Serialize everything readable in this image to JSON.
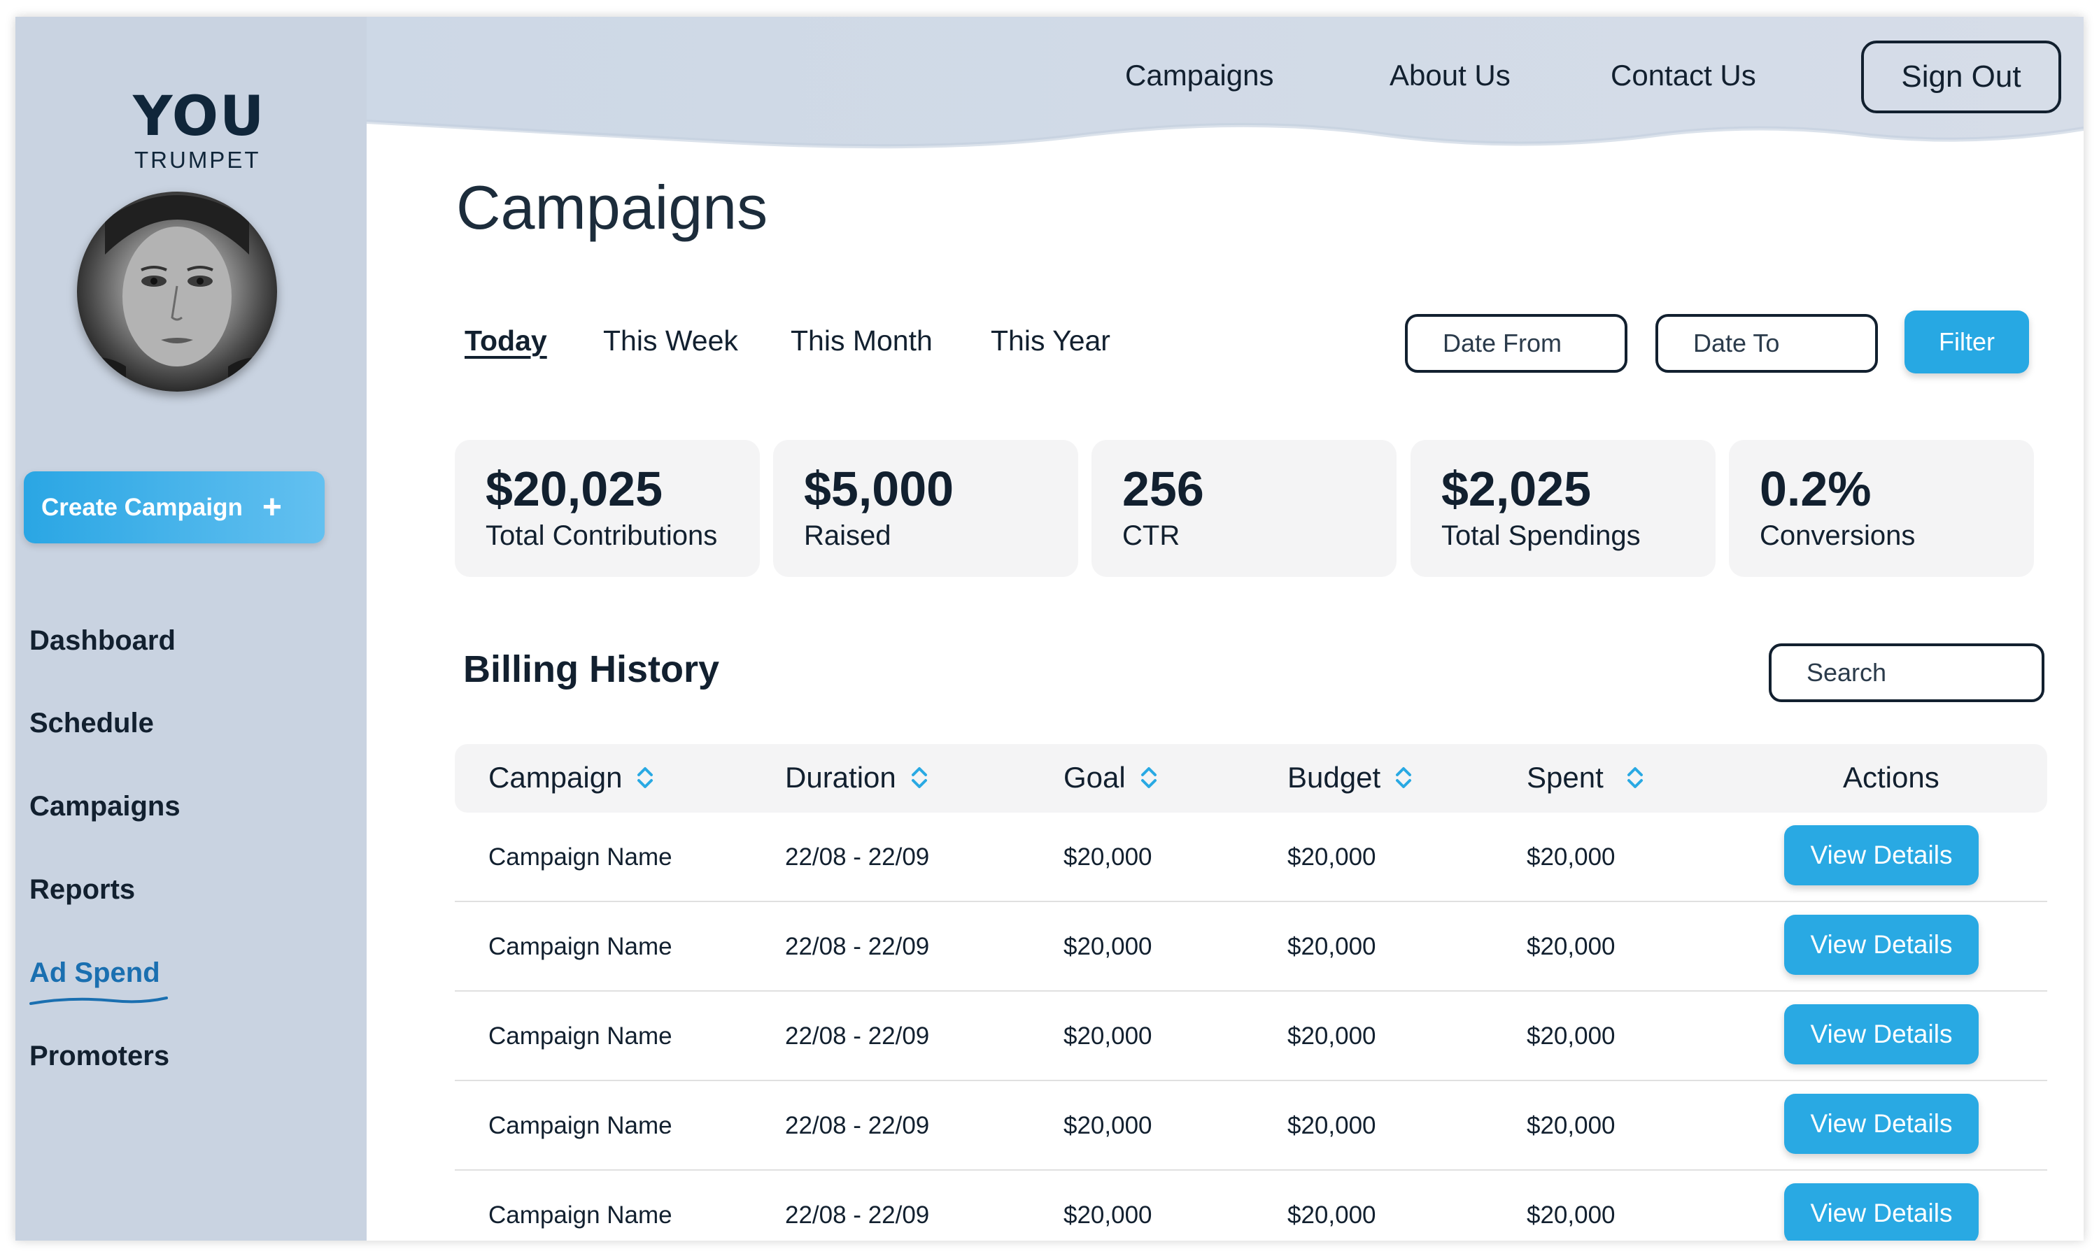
{
  "app": {
    "logo_you": "YOU",
    "logo_trumpet": "TRUMPET"
  },
  "sidebar": {
    "create_label": "Create Campaign",
    "create_icon": "+",
    "items": [
      {
        "label": "Dashboard",
        "active": false
      },
      {
        "label": "Schedule",
        "active": false
      },
      {
        "label": "Campaigns",
        "active": false
      },
      {
        "label": "Reports",
        "active": false
      },
      {
        "label": "Ad Spend",
        "active": true
      },
      {
        "label": "Promoters",
        "active": false
      }
    ]
  },
  "header": {
    "links": [
      "Campaigns",
      "About Us",
      "Contact Us"
    ],
    "signout_label": "Sign Out"
  },
  "main": {
    "title": "Campaigns",
    "tabs": [
      {
        "label": "Today",
        "active": true
      },
      {
        "label": "This Week",
        "active": false
      },
      {
        "label": "This Month",
        "active": false
      },
      {
        "label": "This Year",
        "active": false
      }
    ],
    "date_from_placeholder": "Date From",
    "date_to_placeholder": "Date To",
    "filter_label": "Filter",
    "stats": [
      {
        "value": "$20,025",
        "label": "Total Contributions"
      },
      {
        "value": "$5,000",
        "label": "Raised"
      },
      {
        "value": "256",
        "label": "CTR"
      },
      {
        "value": "$2,025",
        "label": "Total Spendings"
      },
      {
        "value": "0.2%",
        "label": "Conversions"
      }
    ]
  },
  "billing": {
    "title": "Billing History",
    "search_placeholder": "Search",
    "columns": [
      "Campaign",
      "Duration",
      "Goal",
      "Budget",
      "Spent",
      "Actions"
    ],
    "action_label": "View Details",
    "rows": [
      {
        "campaign": "Campaign Name",
        "duration": "22/08 - 22/09",
        "goal": "$20,000",
        "budget": "$20,000",
        "spent": "$20,000"
      },
      {
        "campaign": "Campaign Name",
        "duration": "22/08 - 22/09",
        "goal": "$20,000",
        "budget": "$20,000",
        "spent": "$20,000"
      },
      {
        "campaign": "Campaign Name",
        "duration": "22/08 - 22/09",
        "goal": "$20,000",
        "budget": "$20,000",
        "spent": "$20,000"
      },
      {
        "campaign": "Campaign Name",
        "duration": "22/08 - 22/09",
        "goal": "$20,000",
        "budget": "$20,000",
        "spent": "$20,000"
      },
      {
        "campaign": "Campaign Name",
        "duration": "22/08 - 22/09",
        "goal": "$20,000",
        "budget": "$20,000",
        "spent": "$20,000"
      }
    ]
  },
  "colors": {
    "accent": "#29a9e3",
    "sidebar_bg": "#c9d3e1",
    "active_nav": "#1a6fb0",
    "text": "#12202f"
  }
}
